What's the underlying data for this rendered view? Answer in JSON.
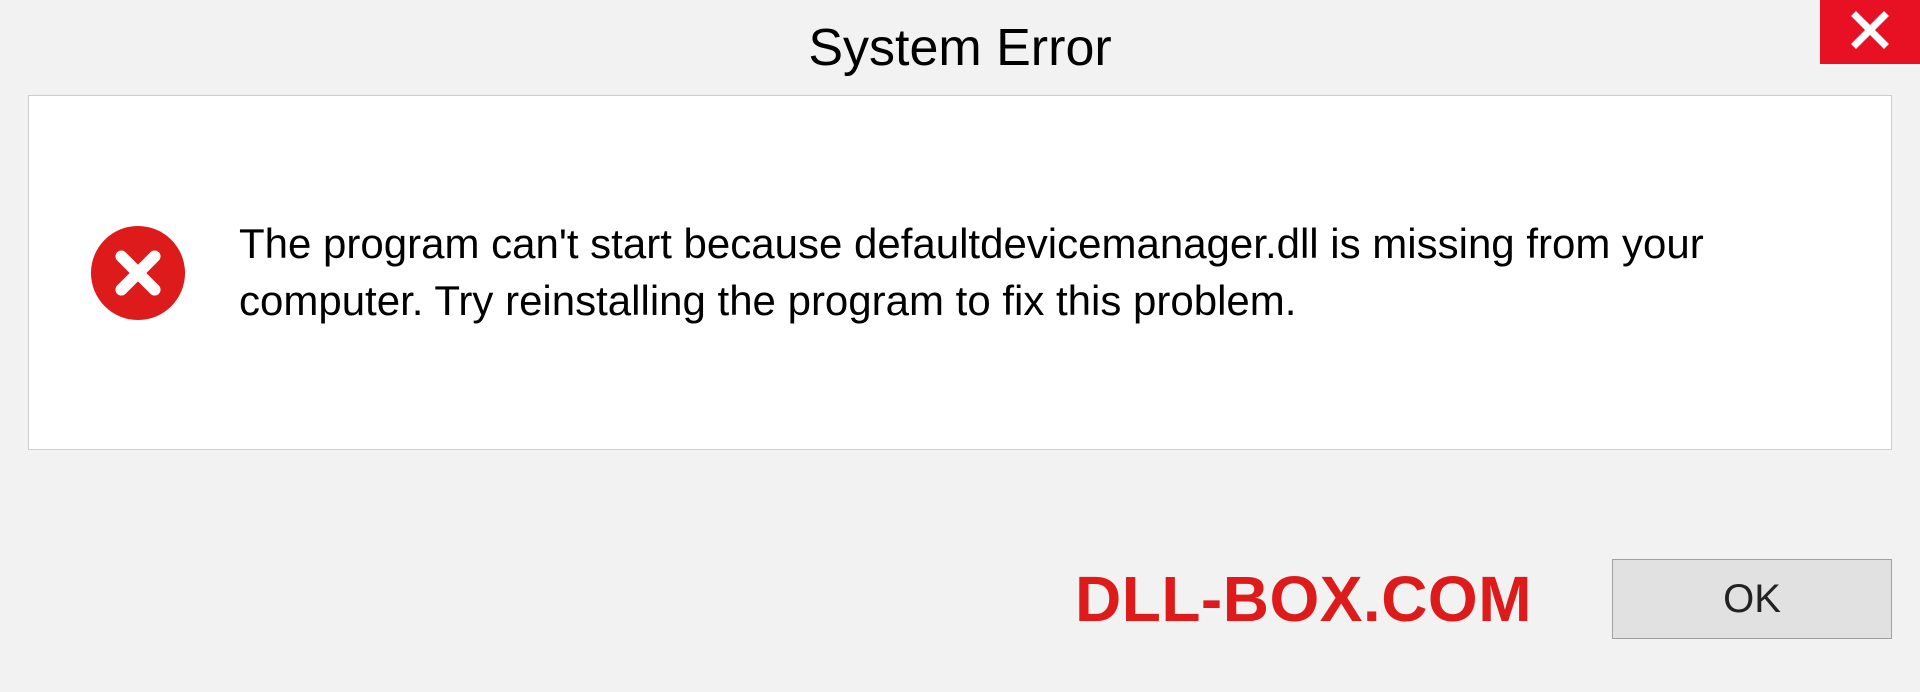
{
  "dialog": {
    "title": "System Error",
    "message": "The program can't start because defaultdevicemanager.dll is missing from your computer. Try reinstalling the program to fix this problem.",
    "ok_label": "OK"
  },
  "watermark": "DLL-BOX.COM",
  "colors": {
    "close_bg": "#e81123",
    "error_red": "#dd1b1a"
  }
}
